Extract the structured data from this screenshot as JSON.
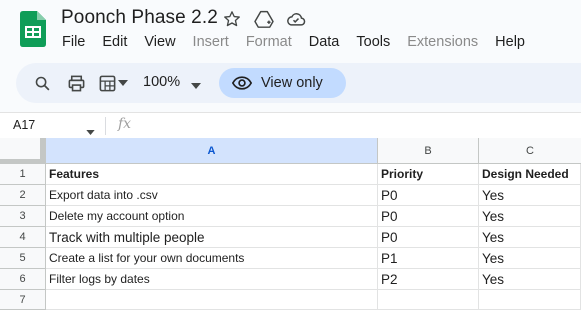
{
  "app": {
    "title": "Poonch Phase 2.2",
    "menu": [
      {
        "label": "File",
        "enabled": true
      },
      {
        "label": "Edit",
        "enabled": true
      },
      {
        "label": "View",
        "enabled": true
      },
      {
        "label": "Insert",
        "enabled": false
      },
      {
        "label": "Format",
        "enabled": false
      },
      {
        "label": "Data",
        "enabled": true
      },
      {
        "label": "Tools",
        "enabled": true
      },
      {
        "label": "Extensions",
        "enabled": false
      },
      {
        "label": "Help",
        "enabled": true
      }
    ]
  },
  "toolbar": {
    "zoom": "100%",
    "mode_label": "View only",
    "icons": [
      "search-icon",
      "print-icon",
      "format-icon",
      "eye-icon"
    ]
  },
  "formula_bar": {
    "name_box": "A17",
    "fx_label": "fx"
  },
  "sheet": {
    "columns": [
      "A",
      "B",
      "C"
    ],
    "rows": [
      "1",
      "2",
      "3",
      "4",
      "5",
      "6",
      "7"
    ],
    "cells": [
      [
        "Features",
        "Priority",
        "Design Needed"
      ],
      [
        "Export data into .csv",
        "P0",
        "Yes"
      ],
      [
        "Delete my account option",
        "P0",
        "Yes"
      ],
      [
        "Track with multiple people",
        "P0",
        "Yes"
      ],
      [
        "Create a list for your own documents",
        "P1",
        "Yes"
      ],
      [
        "Filter logs by dates",
        "P2",
        "Yes"
      ],
      [
        "",
        "",
        ""
      ]
    ]
  },
  "colors": {
    "accent": "#0b57d0",
    "toolbar_bg": "#edf2fa",
    "view_only_bg": "#c2dbff",
    "selected_col_bg": "#d3e3fd",
    "sheets_green": "#0f9d58"
  }
}
